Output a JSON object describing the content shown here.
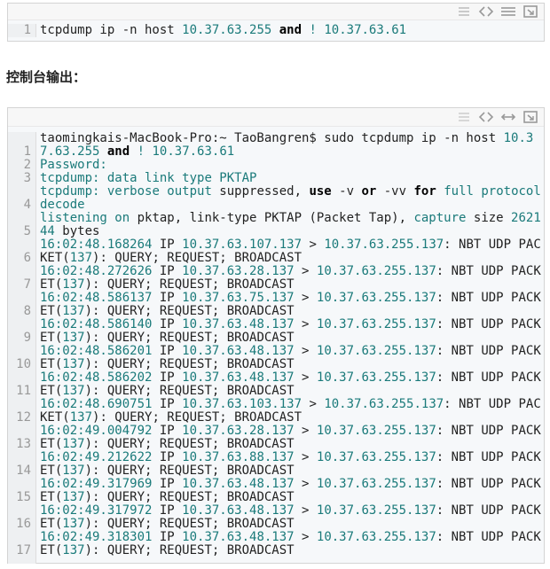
{
  "snippet1": {
    "line_number": "1",
    "tokens": [
      {
        "t": "tcpdump ip -n host ",
        "c": "pl"
      },
      {
        "t": "10.37.63.255",
        "c": "num"
      },
      {
        "t": " ",
        "c": "pl"
      },
      {
        "t": "and",
        "c": "kw"
      },
      {
        "t": " ",
        "c": "pl"
      },
      {
        "t": "!",
        "c": "op"
      },
      {
        "t": " ",
        "c": "pl"
      },
      {
        "t": "10.37.63.61",
        "c": "num"
      }
    ]
  },
  "heading": "控制台输出：",
  "snippet2": {
    "lines": [
      {
        "n": "1",
        "tokens": [
          {
            "t": "taomingkais-MacBook-Pro:~ TaoBangren$ sudo tcpdump ip -n host ",
            "c": "pl"
          },
          {
            "t": "10.37.63.255",
            "c": "num"
          },
          {
            "t": " ",
            "c": "pl"
          },
          {
            "t": "and",
            "c": "kw"
          },
          {
            "t": " ",
            "c": "pl"
          },
          {
            "t": "!",
            "c": "op"
          },
          {
            "t": " ",
            "c": "pl"
          },
          {
            "t": "10.37.63.61",
            "c": "num"
          }
        ]
      },
      {
        "n": "2",
        "tokens": [
          {
            "t": "Password:",
            "c": "fn"
          }
        ]
      },
      {
        "n": "3",
        "tokens": [
          {
            "t": "tcpdump:",
            "c": "fn"
          },
          {
            "t": " data link type PKTAP",
            "c": "fn"
          }
        ]
      },
      {
        "n": "4",
        "tokens": [
          {
            "t": "tcpdump:",
            "c": "fn"
          },
          {
            "t": " verbose output ",
            "c": "fn"
          },
          {
            "t": "suppressed, ",
            "c": "pl"
          },
          {
            "t": "use",
            "c": "kw"
          },
          {
            "t": " -v ",
            "c": "pl"
          },
          {
            "t": "or",
            "c": "kw"
          },
          {
            "t": " -vv ",
            "c": "pl"
          },
          {
            "t": "for",
            "c": "kw"
          },
          {
            "t": " full protocol decode",
            "c": "fn"
          }
        ]
      },
      {
        "n": "5",
        "tokens": [
          {
            "t": "listening on",
            "c": "fn"
          },
          {
            "t": " pktap, link-type PKTAP (Packet Tap), ",
            "c": "pl"
          },
          {
            "t": "capture",
            "c": "fn"
          },
          {
            "t": " size ",
            "c": "pl"
          },
          {
            "t": "262144",
            "c": "num"
          },
          {
            "t": " bytes",
            "c": "pl"
          }
        ]
      },
      {
        "n": "6",
        "tokens": [
          {
            "t": "16:02:48.168264",
            "c": "num"
          },
          {
            "t": " IP ",
            "c": "pl"
          },
          {
            "t": "10.37.63.107.137",
            "c": "num"
          },
          {
            "t": " > ",
            "c": "pl"
          },
          {
            "t": "10.37.63.255.137",
            "c": "num"
          },
          {
            "t": ": NBT UDP PACKET(",
            "c": "pl"
          },
          {
            "t": "137",
            "c": "num"
          },
          {
            "t": "): QUERY; REQUEST; BROADCAST",
            "c": "pl"
          }
        ]
      },
      {
        "n": "7",
        "tokens": [
          {
            "t": "16:02:48.272626",
            "c": "num"
          },
          {
            "t": " IP ",
            "c": "pl"
          },
          {
            "t": "10.37.63.28.137",
            "c": "num"
          },
          {
            "t": " > ",
            "c": "pl"
          },
          {
            "t": "10.37.63.255.137",
            "c": "num"
          },
          {
            "t": ": NBT UDP PACKET(",
            "c": "pl"
          },
          {
            "t": "137",
            "c": "num"
          },
          {
            "t": "): QUERY; REQUEST; BROADCAST",
            "c": "pl"
          }
        ]
      },
      {
        "n": "8",
        "tokens": [
          {
            "t": "16:02:48.586137",
            "c": "num"
          },
          {
            "t": " IP ",
            "c": "pl"
          },
          {
            "t": "10.37.63.75.137",
            "c": "num"
          },
          {
            "t": " > ",
            "c": "pl"
          },
          {
            "t": "10.37.63.255.137",
            "c": "num"
          },
          {
            "t": ": NBT UDP PACKET(",
            "c": "pl"
          },
          {
            "t": "137",
            "c": "num"
          },
          {
            "t": "): QUERY; REQUEST; BROADCAST",
            "c": "pl"
          }
        ]
      },
      {
        "n": "9",
        "tokens": [
          {
            "t": "16:02:48.586140",
            "c": "num"
          },
          {
            "t": " IP ",
            "c": "pl"
          },
          {
            "t": "10.37.63.48.137",
            "c": "num"
          },
          {
            "t": " > ",
            "c": "pl"
          },
          {
            "t": "10.37.63.255.137",
            "c": "num"
          },
          {
            "t": ": NBT UDP PACKET(",
            "c": "pl"
          },
          {
            "t": "137",
            "c": "num"
          },
          {
            "t": "): QUERY; REQUEST; BROADCAST",
            "c": "pl"
          }
        ]
      },
      {
        "n": "10",
        "tokens": [
          {
            "t": "16:02:48.586201",
            "c": "num"
          },
          {
            "t": " IP ",
            "c": "pl"
          },
          {
            "t": "10.37.63.48.137",
            "c": "num"
          },
          {
            "t": " > ",
            "c": "pl"
          },
          {
            "t": "10.37.63.255.137",
            "c": "num"
          },
          {
            "t": ": NBT UDP PACKET(",
            "c": "pl"
          },
          {
            "t": "137",
            "c": "num"
          },
          {
            "t": "): QUERY; REQUEST; BROADCAST",
            "c": "pl"
          }
        ]
      },
      {
        "n": "11",
        "tokens": [
          {
            "t": "16:02:48.586202",
            "c": "num"
          },
          {
            "t": " IP ",
            "c": "pl"
          },
          {
            "t": "10.37.63.48.137",
            "c": "num"
          },
          {
            "t": " > ",
            "c": "pl"
          },
          {
            "t": "10.37.63.255.137",
            "c": "num"
          },
          {
            "t": ": NBT UDP PACKET(",
            "c": "pl"
          },
          {
            "t": "137",
            "c": "num"
          },
          {
            "t": "): QUERY; REQUEST; BROADCAST",
            "c": "pl"
          }
        ]
      },
      {
        "n": "12",
        "tokens": [
          {
            "t": "16:02:48.690751",
            "c": "num"
          },
          {
            "t": " IP ",
            "c": "pl"
          },
          {
            "t": "10.37.63.103.137",
            "c": "num"
          },
          {
            "t": " > ",
            "c": "pl"
          },
          {
            "t": "10.37.63.255.137",
            "c": "num"
          },
          {
            "t": ": NBT UDP PACKET(",
            "c": "pl"
          },
          {
            "t": "137",
            "c": "num"
          },
          {
            "t": "): QUERY; REQUEST; BROADCAST",
            "c": "pl"
          }
        ]
      },
      {
        "n": "13",
        "tokens": [
          {
            "t": "16:02:49.004792",
            "c": "num"
          },
          {
            "t": " IP ",
            "c": "pl"
          },
          {
            "t": "10.37.63.28.137",
            "c": "num"
          },
          {
            "t": " > ",
            "c": "pl"
          },
          {
            "t": "10.37.63.255.137",
            "c": "num"
          },
          {
            "t": ": NBT UDP PACKET(",
            "c": "pl"
          },
          {
            "t": "137",
            "c": "num"
          },
          {
            "t": "): QUERY; REQUEST; BROADCAST",
            "c": "pl"
          }
        ]
      },
      {
        "n": "14",
        "tokens": [
          {
            "t": "16:02:49.212622",
            "c": "num"
          },
          {
            "t": " IP ",
            "c": "pl"
          },
          {
            "t": "10.37.63.88.137",
            "c": "num"
          },
          {
            "t": " > ",
            "c": "pl"
          },
          {
            "t": "10.37.63.255.137",
            "c": "num"
          },
          {
            "t": ": NBT UDP PACKET(",
            "c": "pl"
          },
          {
            "t": "137",
            "c": "num"
          },
          {
            "t": "): QUERY; REQUEST; BROADCAST",
            "c": "pl"
          }
        ]
      },
      {
        "n": "15",
        "tokens": [
          {
            "t": "16:02:49.317969",
            "c": "num"
          },
          {
            "t": " IP ",
            "c": "pl"
          },
          {
            "t": "10.37.63.48.137",
            "c": "num"
          },
          {
            "t": " > ",
            "c": "pl"
          },
          {
            "t": "10.37.63.255.137",
            "c": "num"
          },
          {
            "t": ": NBT UDP PACKET(",
            "c": "pl"
          },
          {
            "t": "137",
            "c": "num"
          },
          {
            "t": "): QUERY; REQUEST; BROADCAST",
            "c": "pl"
          }
        ]
      },
      {
        "n": "16",
        "tokens": [
          {
            "t": "16:02:49.317972",
            "c": "num"
          },
          {
            "t": " IP ",
            "c": "pl"
          },
          {
            "t": "10.37.63.48.137",
            "c": "num"
          },
          {
            "t": " > ",
            "c": "pl"
          },
          {
            "t": "10.37.63.255.137",
            "c": "num"
          },
          {
            "t": ": NBT UDP PACKET(",
            "c": "pl"
          },
          {
            "t": "137",
            "c": "num"
          },
          {
            "t": "): QUERY; REQUEST; BROADCAST",
            "c": "pl"
          }
        ]
      },
      {
        "n": "17",
        "tokens": [
          {
            "t": "16:02:49.318301",
            "c": "num"
          },
          {
            "t": " IP ",
            "c": "pl"
          },
          {
            "t": "10.37.63.48.137",
            "c": "num"
          },
          {
            "t": " > ",
            "c": "pl"
          },
          {
            "t": "10.37.63.255.137",
            "c": "num"
          },
          {
            "t": ": NBT UDP PACKET(",
            "c": "pl"
          },
          {
            "t": "137",
            "c": "num"
          },
          {
            "t": "): QUERY; REQUEST; BROADCAST",
            "c": "pl"
          }
        ]
      }
    ]
  },
  "toolbar_icons": [
    "list-view-icon",
    "code-view-icon",
    "wrap-lines-icon",
    "expand-icon"
  ],
  "colors": {
    "number": "#1a7a7a",
    "keyword": "#000000",
    "gutter": "#eef0f2",
    "background": "#f6f8fa"
  }
}
